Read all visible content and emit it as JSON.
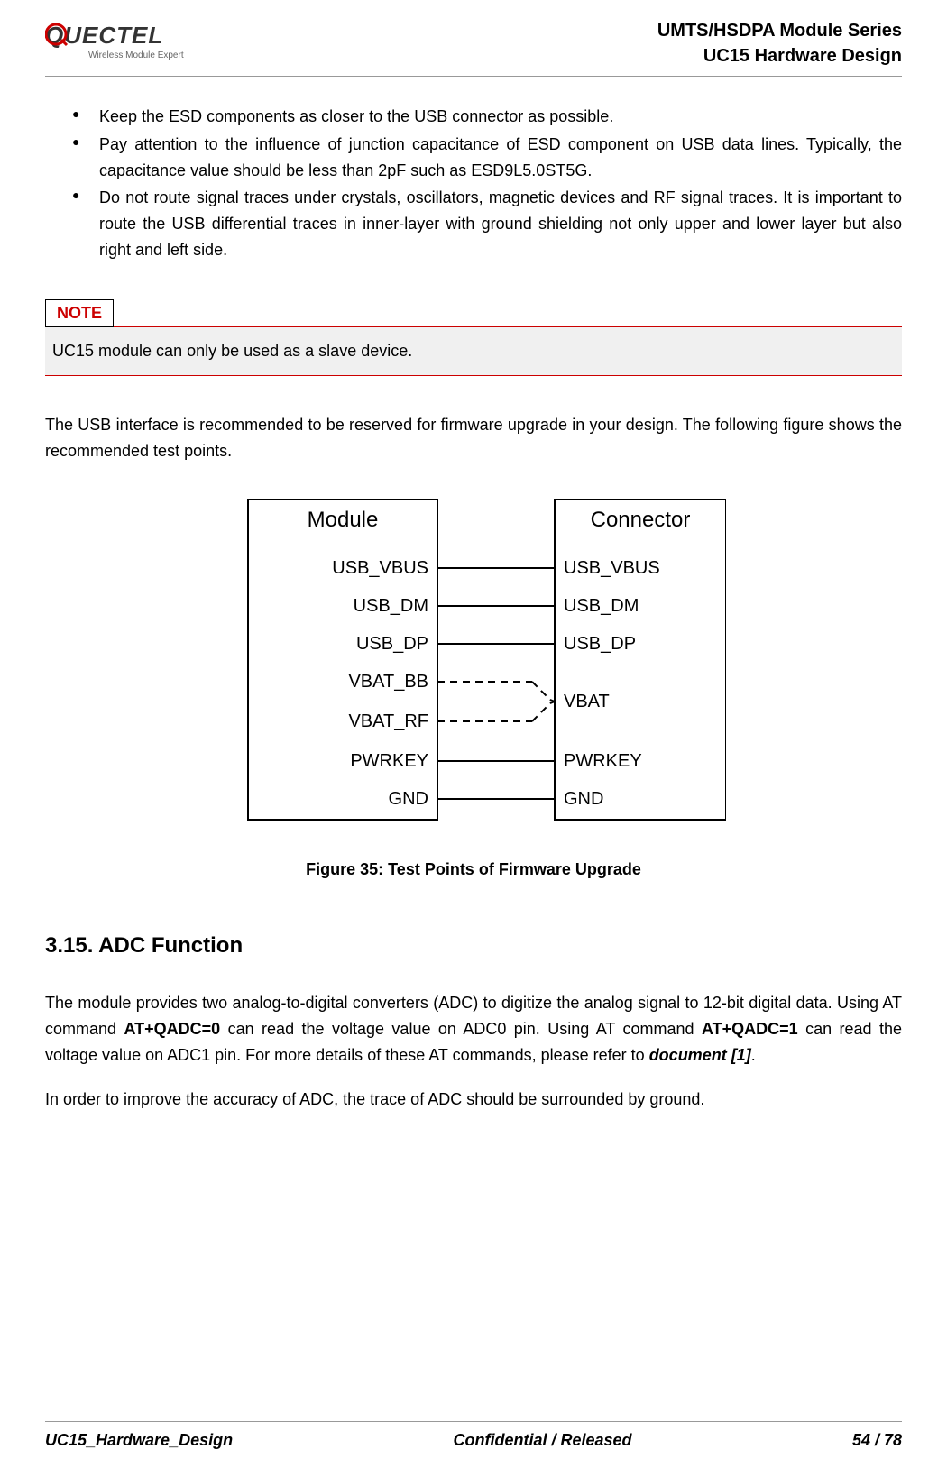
{
  "header": {
    "brand": "QUECTEL",
    "tagline": "Wireless Module Expert",
    "line1": "UMTS/HSDPA  Module  Series",
    "line2": "UC15  Hardware  Design"
  },
  "bullets": [
    "Keep the ESD components as closer to the USB connector as possible.",
    "Pay attention to the influence of junction capacitance of ESD component on USB data lines. Typically, the capacitance value should be less than 2pF such as ESD9L5.0ST5G.",
    "Do not route signal traces under crystals, oscillators, magnetic devices and RF signal traces. It is important to route the USB differential traces in inner-layer with ground shielding not only upper and lower layer but also right and left side."
  ],
  "note": {
    "label": "NOTE",
    "text": "UC15 module can only be used as a slave device."
  },
  "paragraph1": "The USB interface is recommended to be reserved for firmware upgrade in your design. The following figure shows the recommended test points.",
  "diagram": {
    "left_title": "Module",
    "right_title": "Connector",
    "left_pins": [
      "USB_VBUS",
      "USB_DM",
      "USB_DP",
      "VBAT_BB",
      "VBAT_RF",
      "PWRKEY",
      "GND"
    ],
    "right_pins": [
      "USB_VBUS",
      "USB_DM",
      "USB_DP",
      "VBAT",
      "PWRKEY",
      "GND"
    ]
  },
  "figure_caption": "Figure 35: Test Points of Firmware Upgrade",
  "section": {
    "heading": "3.15. ADC Function",
    "p1_part1": "The module provides two analog-to-digital converters (ADC) to digitize the analog signal to 12-bit digital data. Using AT command ",
    "p1_bold1": "AT+QADC=0",
    "p1_part2": " can read the voltage value on ADC0 pin. Using AT command ",
    "p1_bold2": "AT+QADC=1",
    "p1_part3": " can read the voltage value on ADC1 pin. For more details of these AT commands, please refer to ",
    "p1_italic": "document [1]",
    "p1_part4": ".",
    "p2": "In order to improve the accuracy of ADC, the trace of ADC should be surrounded by ground."
  },
  "footer": {
    "left": "UC15_Hardware_Design",
    "center": "Confidential / Released",
    "right": "54 / 78"
  }
}
